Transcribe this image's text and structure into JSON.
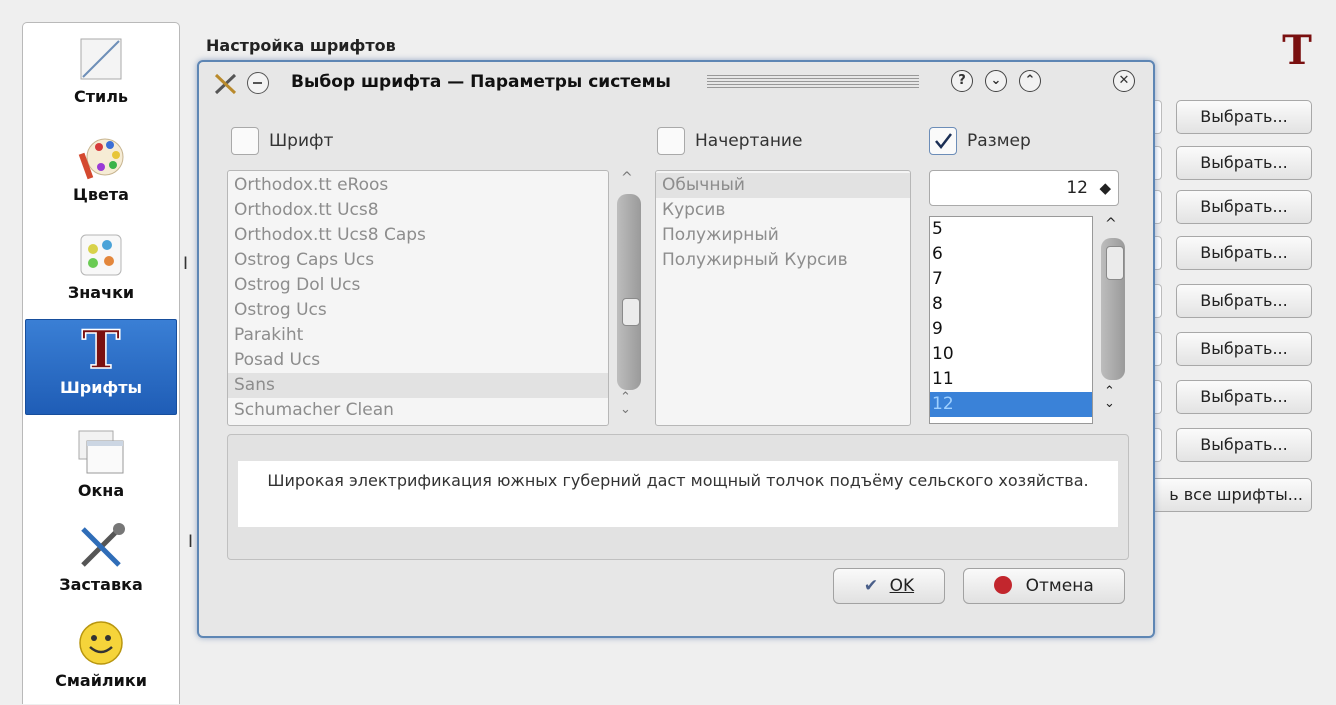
{
  "window_title": "Настройка шрифтов",
  "sidebar": {
    "items": [
      {
        "label": "Стиль",
        "icon": "style-icon"
      },
      {
        "label": "Цвета",
        "icon": "colors-icon"
      },
      {
        "label": "Значки",
        "icon": "icons-icon"
      },
      {
        "label": "Шрифты",
        "icon": "fonts-icon",
        "selected": true
      },
      {
        "label": "Окна",
        "icon": "windows-icon"
      },
      {
        "label": "Заставка",
        "icon": "screensaver-icon"
      },
      {
        "label": "Смайлики",
        "icon": "smileys-icon"
      }
    ]
  },
  "background_page": {
    "choose_buttons": [
      "Выбрать...",
      "Выбрать...",
      "Выбрать...",
      "Выбрать...",
      "Выбрать...",
      "Выбрать...",
      "Выбрать...",
      "Выбрать..."
    ],
    "adjust_all_button": "ь все шрифты...",
    "stub_left_1": "I",
    "stub_left_2": "I"
  },
  "dialog": {
    "title": "Выбор шрифта — Параметры системы",
    "titlebar_buttons": [
      "?",
      "⌄",
      "⌃",
      "✕"
    ],
    "font_checkbox_label": "Шрифт",
    "style_checkbox_label": "Начертание",
    "size_checkbox_label": "Размер",
    "size_checkbox_checked": true,
    "font_list": [
      "Orthodox.tt eRoos",
      "Orthodox.tt Ucs8",
      "Orthodox.tt Ucs8 Caps",
      "Ostrog Caps Ucs",
      "Ostrog Dol Ucs",
      "Ostrog Ucs",
      "Parakiht",
      "Posad Ucs",
      "Sans",
      "Schumacher Clean"
    ],
    "font_selected": "Sans",
    "style_list": [
      "Обычный",
      "Курсив",
      "Полужирный",
      "Полужирный Курсив"
    ],
    "style_selected": "Обычный",
    "size_value": "12",
    "size_list": [
      "5",
      "6",
      "7",
      "8",
      "9",
      "10",
      "11",
      "12"
    ],
    "size_selected": "12",
    "preview_text": "Широкая электрификация южных губерний даст мощный толчок подъёму сельского хозяйства.",
    "ok_label": "OK",
    "cancel_label": "Отмена"
  },
  "colors": {
    "selection_blue": "#3a82d8",
    "dialog_border": "#5e86b4",
    "sidebar_selected": "#2a6ec8"
  }
}
